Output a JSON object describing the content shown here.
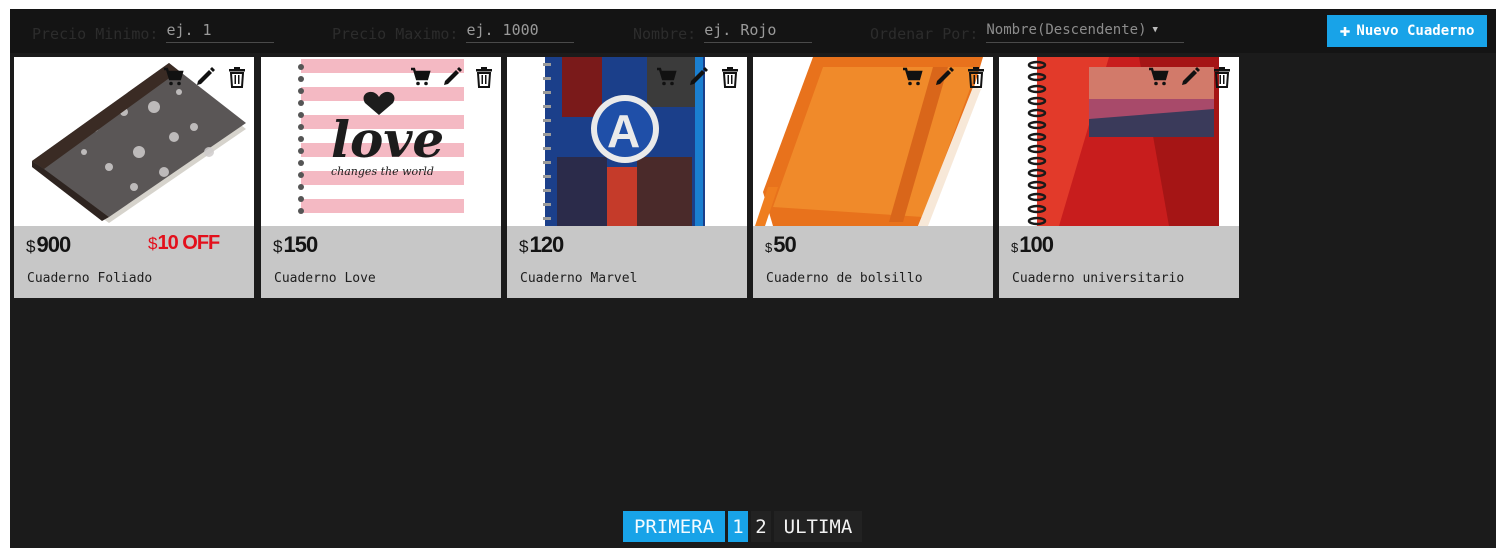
{
  "filters": {
    "min_price_label": "Precio Minimo:",
    "min_price_placeholder": "ej. 1",
    "max_price_label": "Precio Maximo:",
    "max_price_placeholder": "ej. 1000",
    "name_label": "Nombre:",
    "name_placeholder": "ej. Rojo",
    "sort_label": "Ordenar Por:",
    "sort_value": "Nombre(Descendente)"
  },
  "new_button_label": "Nuevo Cuaderno",
  "currency_symbol": "$",
  "products": [
    {
      "name": "Cuaderno Foliado",
      "price": "900",
      "discount": "10 OFF",
      "image": "composition-notebook"
    },
    {
      "name": "Cuaderno Love",
      "price": "150",
      "discount": "",
      "image": "love-notebook"
    },
    {
      "name": "Cuaderno Marvel",
      "price": "120",
      "discount": "",
      "image": "marvel-notebook"
    },
    {
      "name": "Cuaderno de bolsillo",
      "price": "50",
      "discount": "",
      "image": "orange-pocket-notebook"
    },
    {
      "name": "Cuaderno universitario",
      "price": "100",
      "discount": "",
      "image": "university-notebook"
    }
  ],
  "pagination": {
    "first": "PRIMERA",
    "pages": [
      "1",
      "2"
    ],
    "current": "1",
    "last": "ULTIMA"
  },
  "colors": {
    "accent": "#18a3e8",
    "discount": "#e3101c",
    "background": "#1b1b1b",
    "card": "#c7c7c7"
  }
}
